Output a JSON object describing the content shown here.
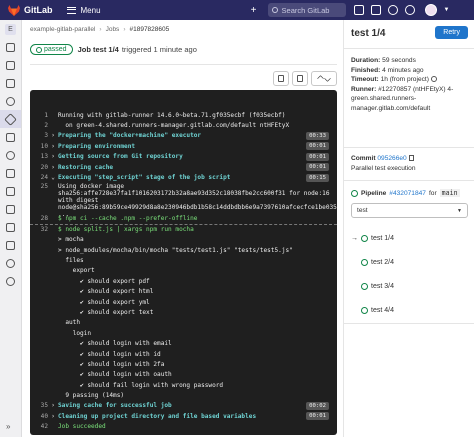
{
  "topbar": {
    "app_name": "GitLab",
    "menu_label": "Menu",
    "search_placeholder": "Search GitLab"
  },
  "sidebar": {
    "project_initial": "E"
  },
  "breadcrumb": {
    "project": "example-gitlab-parallel",
    "jobs": "Jobs",
    "job_id": "#1897828605"
  },
  "job_header": {
    "status": "passed",
    "title": "Job test 1/4",
    "triggered": "triggered 1 minute ago"
  },
  "log": {
    "lines": [
      {
        "num": "1",
        "toggle": "",
        "text": "Running with gitlab-runner 14.6.0~beta.71.gf035ecbf (f035ecbf)",
        "cls": ""
      },
      {
        "num": "2",
        "toggle": "",
        "text": "  on green-4.shared.runners-manager.gitlab.com/default ntHFEtyX",
        "cls": ""
      },
      {
        "num": "3",
        "toggle": "›",
        "text": "Preparing the \"docker+machine\" executor",
        "cls": "sec",
        "dur": "00:33"
      },
      {
        "num": "10",
        "toggle": "›",
        "text": "Preparing environment",
        "cls": "sec",
        "dur": "00:01"
      },
      {
        "num": "13",
        "toggle": "›",
        "text": "Getting source from Git repository",
        "cls": "sec",
        "dur": "00:01"
      },
      {
        "num": "20",
        "toggle": "›",
        "text": "Restoring cache",
        "cls": "sec",
        "dur": "00:01"
      },
      {
        "num": "24",
        "toggle": "⌄",
        "text": "Executing \"step_script\" stage of the job script",
        "cls": "sec",
        "dur": "00:15"
      },
      {
        "num": "25",
        "toggle": "",
        "text": "Using docker image sha256:affe728e37fa1f1016203172b32a8ae93d352c18038fbe2cc600f31 for node:16 with digest node@sha256:89b59ce49929d8a8e230946bdb1b58c14ddbdbb6e9a7397610afcecfce1be035 ...",
        "cls": "",
        "wrap": true,
        "h": 31
      },
      {
        "num": "28",
        "toggle": "",
        "text": "$ npm ci --cache .npm --prefer-offline",
        "cls": "green"
      },
      {
        "num": "32",
        "toggle": "",
        "text": "$ node split.js | xargs npm run mocha",
        "cls": "green",
        "warn": true
      },
      {
        "num": "",
        "toggle": "",
        "text": "> mocha",
        "cls": ""
      },
      {
        "num": "",
        "toggle": "",
        "text": "> node_modules/mocha/bin/mocha \"tests/test1.js\" \"tests/test5.js\"",
        "cls": ""
      },
      {
        "num": "",
        "toggle": "",
        "text": "  files",
        "cls": ""
      },
      {
        "num": "",
        "toggle": "",
        "text": "    export",
        "cls": ""
      },
      {
        "num": "",
        "toggle": "",
        "text": "      ✔ should export pdf",
        "cls": ""
      },
      {
        "num": "",
        "toggle": "",
        "text": "      ✔ should export html",
        "cls": ""
      },
      {
        "num": "",
        "toggle": "",
        "text": "      ✔ should export yml",
        "cls": ""
      },
      {
        "num": "",
        "toggle": "",
        "text": "      ✔ should export text",
        "cls": ""
      },
      {
        "num": "",
        "toggle": "",
        "text": "  auth",
        "cls": ""
      },
      {
        "num": "",
        "toggle": "",
        "text": "    login",
        "cls": ""
      },
      {
        "num": "",
        "toggle": "",
        "text": "      ✔ should login with email",
        "cls": ""
      },
      {
        "num": "",
        "toggle": "",
        "text": "      ✔ should login with id",
        "cls": ""
      },
      {
        "num": "",
        "toggle": "",
        "text": "      ✔ should login with 2fa",
        "cls": ""
      },
      {
        "num": "",
        "toggle": "",
        "text": "      ✔ should login with oauth",
        "cls": ""
      },
      {
        "num": "",
        "toggle": "",
        "text": "      ✔ should fail login with wrong password",
        "cls": ""
      },
      {
        "num": "",
        "toggle": "",
        "text": "  9 passing (14ms)",
        "cls": ""
      },
      {
        "num": "35",
        "toggle": "›",
        "text": "Saving cache for successful job",
        "cls": "sec",
        "dur": "00:02"
      },
      {
        "num": "40",
        "toggle": "›",
        "text": "Cleaning up project directory and file based variables",
        "cls": "sec",
        "dur": "00:01"
      },
      {
        "num": "42",
        "toggle": "",
        "text": "Job succeeded",
        "cls": "green"
      }
    ]
  },
  "right_panel": {
    "title": "test 1/4",
    "retry_label": "Retry",
    "duration_label": "Duration:",
    "duration_value": "59 seconds",
    "finished_label": "Finished:",
    "finished_value": "4 minutes ago",
    "timeout_label": "Timeout:",
    "timeout_value": "1h (from project)",
    "runner_label": "Runner:",
    "runner_value": "#12270857 (ntHFEtyX) 4-green.shared.runners-manager.gitlab.com/default",
    "commit_label": "Commit",
    "commit_sha": "095266e0",
    "commit_message": "Parallel test execution",
    "pipeline_label": "Pipeline",
    "pipeline_id": "#432071847",
    "pipeline_for": "for",
    "pipeline_branch": "main",
    "stage_select": "test",
    "jobs": [
      "test 1/4",
      "test 2/4",
      "test 3/4",
      "test 4/4"
    ],
    "status_color": "#108548",
    "retry_color": "#1f75cb"
  }
}
